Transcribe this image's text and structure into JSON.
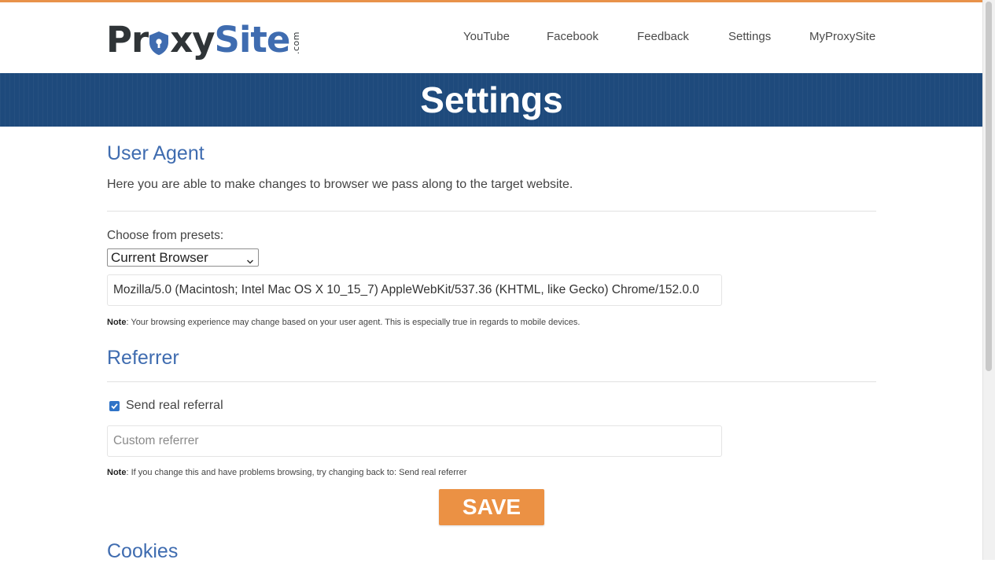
{
  "brand": {
    "logo_text_dark": "Pr",
    "logo_text_dark2": "xy",
    "logo_text_blue": "Site",
    "logo_suffix": ".com"
  },
  "nav": {
    "items": [
      "YouTube",
      "Facebook",
      "Feedback",
      "Settings",
      "MyProxySite"
    ]
  },
  "banner": {
    "title": "Settings"
  },
  "user_agent": {
    "heading": "User Agent",
    "description": "Here you are able to make changes to browser we pass along to the target website.",
    "presets_label": "Choose from presets:",
    "preset_selected": "Current Browser",
    "value": "Mozilla/5.0 (Macintosh; Intel Mac OS X 10_15_7) AppleWebKit/537.36 (KHTML, like Gecko) Chrome/152.0.0",
    "note_label": "Note",
    "note_text": ": Your browsing experience may change based on your user agent. This is especially true in regards to mobile devices."
  },
  "referrer": {
    "heading": "Referrer",
    "checkbox_label": "Send real referral",
    "checkbox_checked": true,
    "custom_placeholder": "Custom referrer",
    "note_label": "Note",
    "note_text": ": If you change this and have problems browsing, try changing back to: Send real referrer"
  },
  "save_button": {
    "label": "SAVE"
  },
  "cookies": {
    "heading": "Cookies"
  },
  "colors": {
    "accent": "#eb9144",
    "brand_blue": "#3f6cb0",
    "banner": "#1e4a7c"
  }
}
